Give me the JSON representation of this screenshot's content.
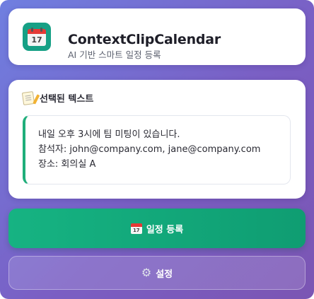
{
  "header": {
    "title": "ContextClipCalendar",
    "subtitle": "AI 기반 스마트 일정 등록",
    "icon": "calendar-icon",
    "icon_day": "17"
  },
  "selected_text": {
    "label": "선택된 텍스트",
    "icon": "memo-icon",
    "lines": [
      "내일 오후 3시에 팀 미팅이 있습니다.",
      "참석자: john@company.com, jane@company.com",
      "장소: 회의실 A"
    ]
  },
  "actions": {
    "register_label": "일정 등록",
    "register_icon": "calendar-icon",
    "register_icon_day": "17",
    "settings_label": "설정",
    "settings_icon": "gear-icon"
  },
  "colors": {
    "background_gradient": [
      "#6f7fe0",
      "#7b55b3"
    ],
    "primary_button": "#16b382",
    "accent_border": "#1fae7a"
  }
}
